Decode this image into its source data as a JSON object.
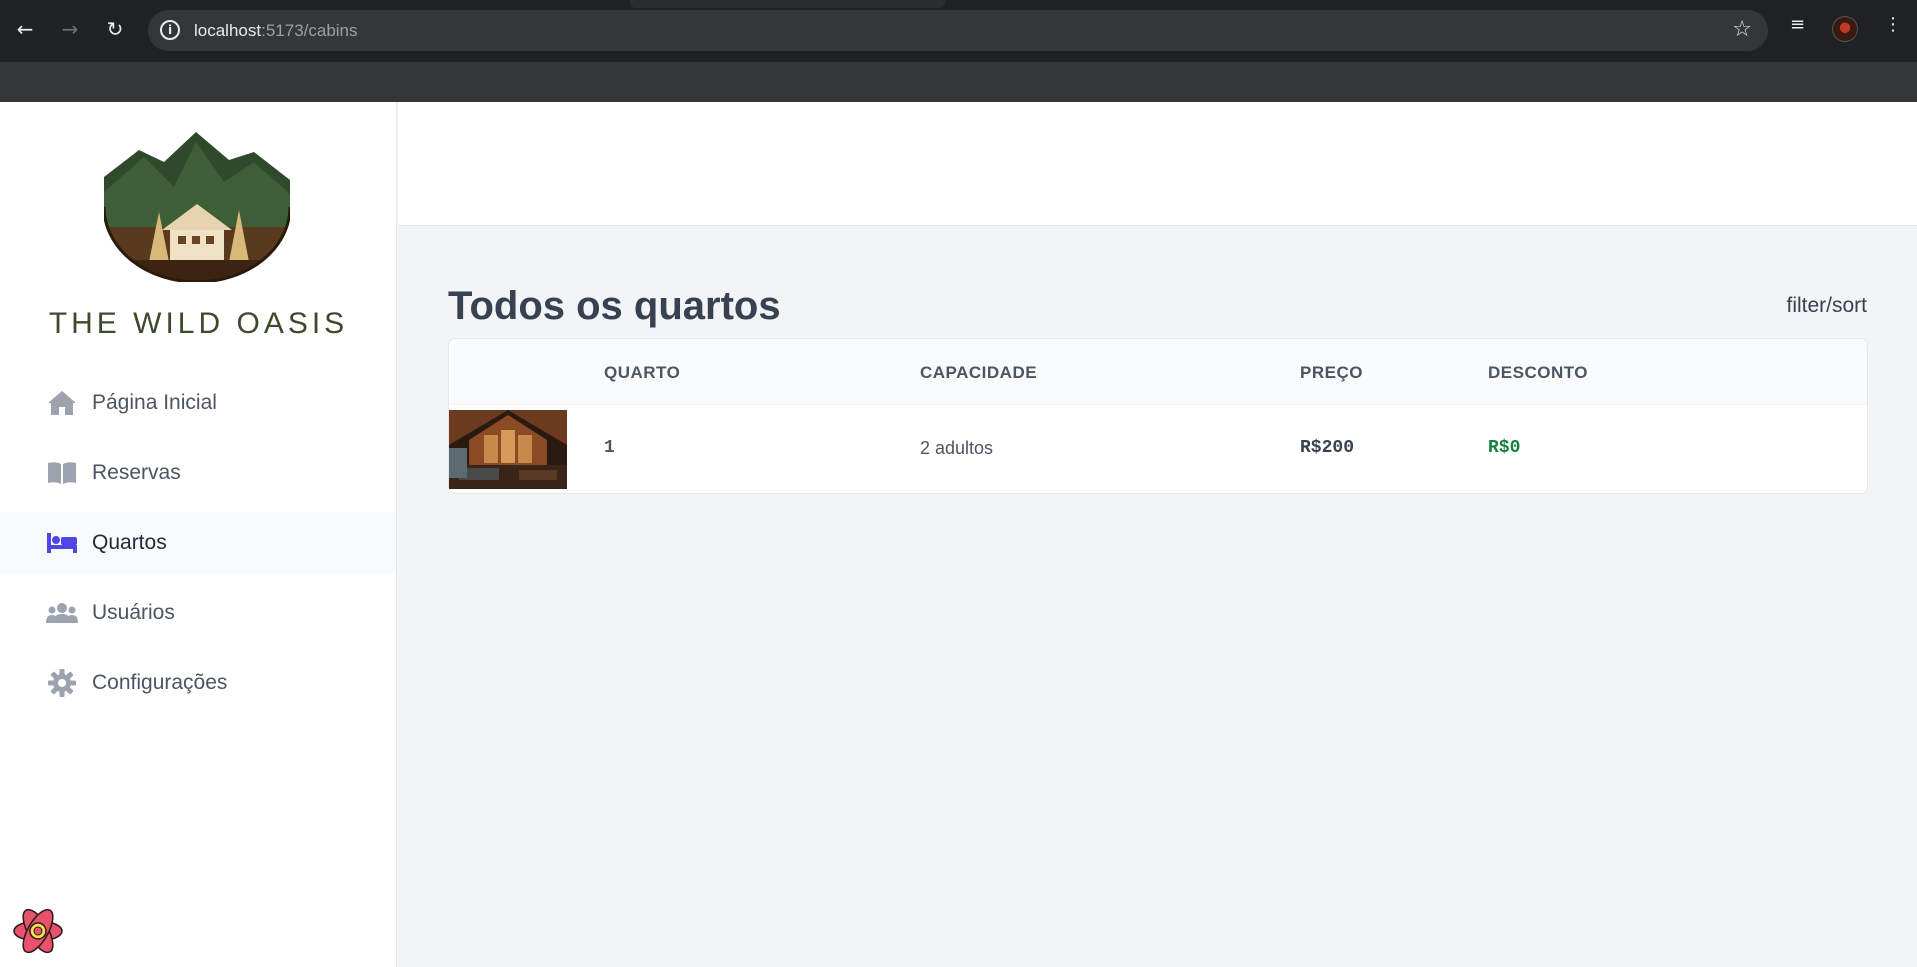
{
  "browser": {
    "url_host": "localhost",
    "url_path": ":5173/cabins",
    "back_icon": "arrow-left-icon",
    "forward_icon": "arrow-right-icon",
    "reload_icon": "reload-icon",
    "info_icon": "info-icon",
    "bookmark_icon": "star-icon",
    "info_glyph": "i",
    "back_glyph": "←",
    "forward_glyph": "→",
    "reload_glyph": "↻",
    "star_glyph": "☆",
    "media_glyph": "≡",
    "menu_glyph": "⋮"
  },
  "sidebar": {
    "brand": "THE WILD OASIS",
    "items": [
      {
        "label": "Página Inicial",
        "icon": "home-icon"
      },
      {
        "label": "Reservas",
        "icon": "book-open-icon"
      },
      {
        "label": "Quartos",
        "icon": "bed-icon",
        "active": true
      },
      {
        "label": "Usuários",
        "icon": "users-icon"
      },
      {
        "label": "Configurações",
        "icon": "gear-icon"
      }
    ]
  },
  "main": {
    "title": "Todos os quartos",
    "filter_sort": "filter/sort",
    "table": {
      "headers": [
        "",
        "QUARTO",
        "CAPACIDADE",
        "PREÇO",
        "DESCONTO"
      ],
      "rows": [
        {
          "name": "1",
          "capacity": "2 adultos",
          "price": "R$200",
          "discount": "R$0"
        }
      ]
    }
  },
  "colors": {
    "accent": "#4f46e5",
    "discount_green": "#15803d",
    "brand_green": "#3d4a2c"
  }
}
